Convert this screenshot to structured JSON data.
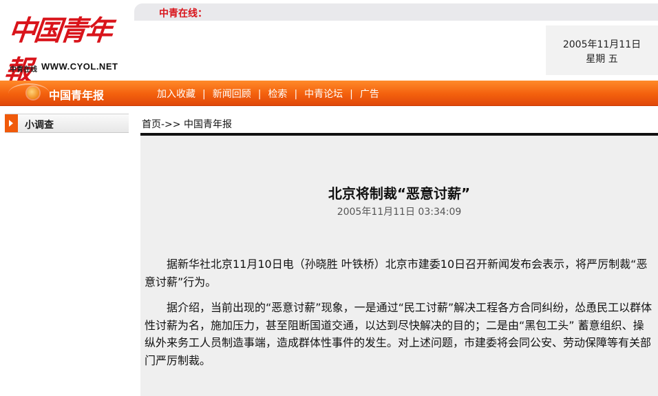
{
  "header": {
    "logo_text": "中国青年報",
    "logo_small": "中青在线",
    "logo_url": "WWW.CYOL.NET",
    "topbar_label": "中青在线：",
    "date": "2005年11月11日",
    "weekday": "星期 五"
  },
  "nav": {
    "brand": "中国青年报",
    "links": [
      "加入收藏",
      "新闻回顾",
      "检索",
      "中青论坛",
      "广告"
    ],
    "separator": "|"
  },
  "sidebar": {
    "title": "小调查"
  },
  "breadcrumb": {
    "home": "首页->>",
    "current": "中国青年报"
  },
  "article": {
    "title": "北京将制裁“恶意讨薪”",
    "timestamp": "2005年11月11日 03:34:09",
    "paragraphs": [
      "据新华社北京11月10日电（孙晓胜 叶铁桥）北京市建委10日召开新闻发布会表示，将严厉制裁“恶意讨薪”行为。",
      "据介绍，当前出现的“恶意讨薪”现象，一是通过“民工讨薪”解决工程各方合同纠纷，怂恿民工以群体性讨薪为名，施加压力，甚至阻断国道交通，以达到尽快解决的目的；二是由“黑包工头” 蓄意组织、操纵外来务工人员制造事端，造成群体性事件的发生。对上述问题，市建委将会同公安、劳动保障等有关部门严厉制裁。"
    ]
  },
  "colors": {
    "brand_red": "#d9141b",
    "nav_orange": "#f3600d",
    "article_bg": "#efefef"
  }
}
